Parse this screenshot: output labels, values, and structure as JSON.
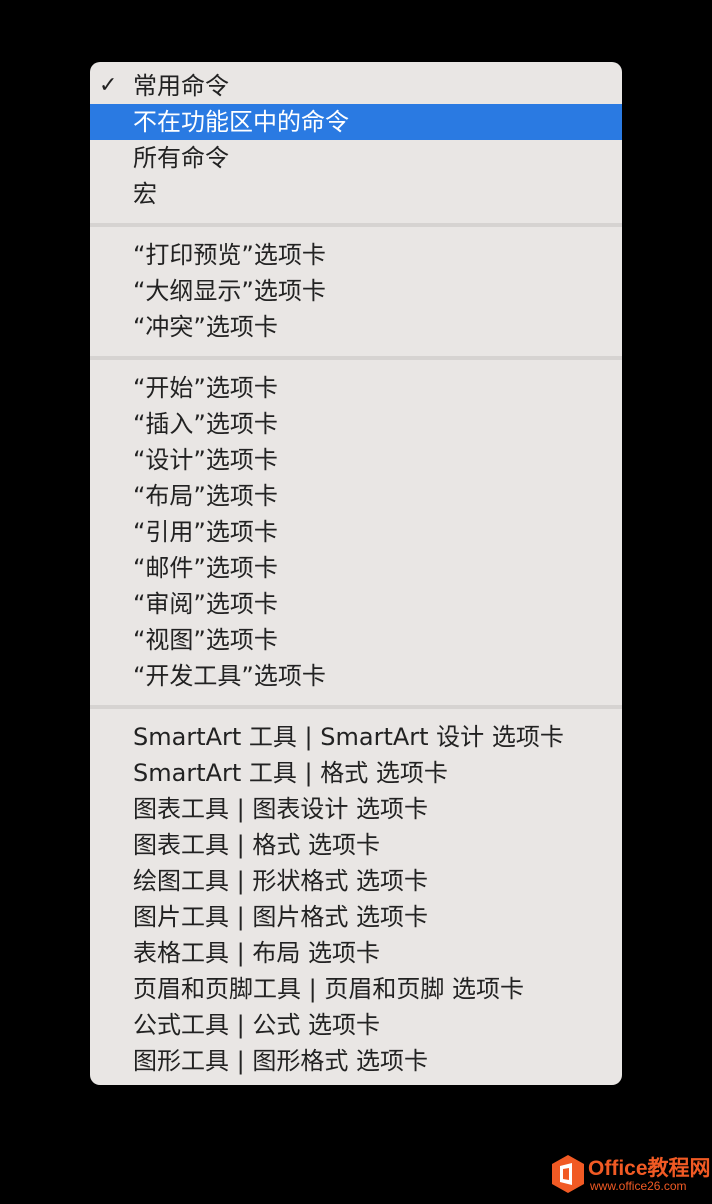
{
  "menu": {
    "check_icon": "checkmark-icon",
    "group1": [
      {
        "label": "常用命令",
        "checked": true
      },
      {
        "label": "不在功能区中的命令",
        "selected": true
      },
      {
        "label": "所有命令"
      },
      {
        "label": "宏"
      }
    ],
    "group2": [
      {
        "label": "“打印预览”选项卡"
      },
      {
        "label": "“大纲显示”选项卡"
      },
      {
        "label": "“冲突”选项卡"
      }
    ],
    "group3": [
      {
        "label": "“开始”选项卡"
      },
      {
        "label": "“插入”选项卡"
      },
      {
        "label": "“设计”选项卡"
      },
      {
        "label": "“布局”选项卡"
      },
      {
        "label": "“引用”选项卡"
      },
      {
        "label": "“邮件”选项卡"
      },
      {
        "label": "“审阅”选项卡"
      },
      {
        "label": "“视图”选项卡"
      },
      {
        "label": "“开发工具”选项卡"
      }
    ],
    "group4": [
      {
        "label": "SmartArt 工具 | SmartArt 设计 选项卡"
      },
      {
        "label": "SmartArt 工具 | 格式 选项卡"
      },
      {
        "label": "图表工具 | 图表设计 选项卡"
      },
      {
        "label": "图表工具 | 格式 选项卡"
      },
      {
        "label": "绘图工具 | 形状格式 选项卡"
      },
      {
        "label": "图片工具 | 图片格式 选项卡"
      },
      {
        "label": "表格工具 | 布局 选项卡"
      },
      {
        "label": "页眉和页脚工具 | 页眉和页脚 选项卡"
      },
      {
        "label": "公式工具 | 公式 选项卡"
      },
      {
        "label": "图形工具 | 图形格式 选项卡"
      }
    ]
  },
  "watermark": {
    "title": "Office教程网",
    "url": "www.office26.com",
    "icon": "office-logo-icon",
    "color": "#f15a24"
  },
  "colors": {
    "menu_background": "#e9e6e4",
    "highlight": "#2a7ae2",
    "separator": "#d6d3d1"
  }
}
